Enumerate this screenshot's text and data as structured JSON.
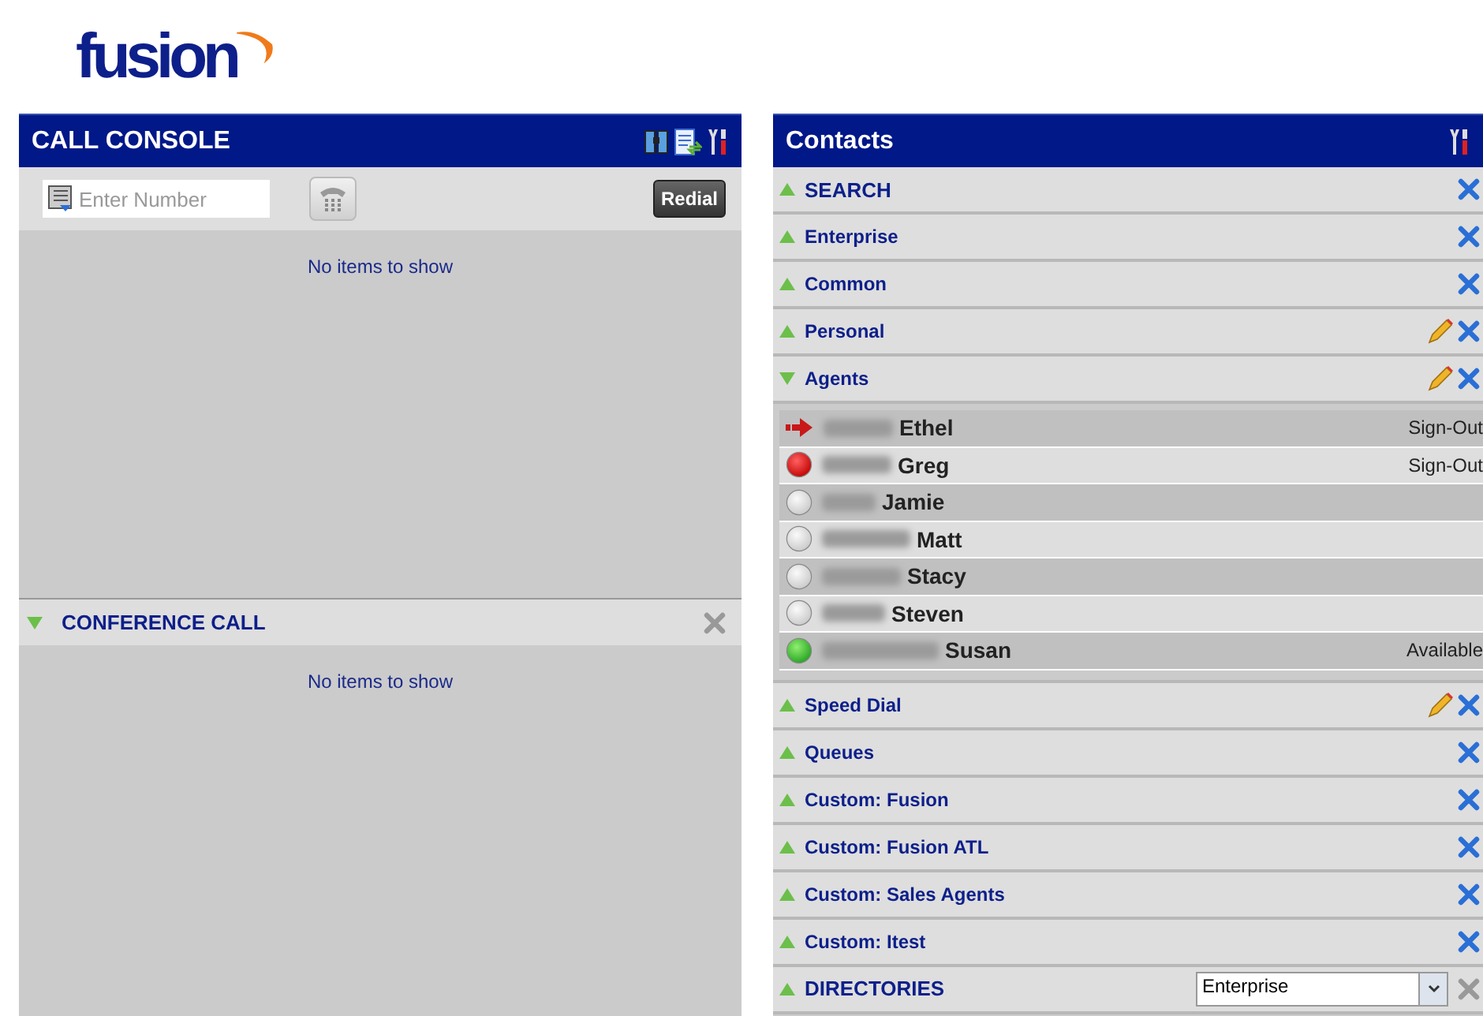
{
  "logo": "fusion",
  "call_console": {
    "title": "CALL CONSOLE",
    "number_placeholder": "Enter Number",
    "redial": "Redial",
    "empty": "No items to show",
    "conference": {
      "title": "CONFERENCE CALL",
      "expanded": true,
      "empty": "No items to show"
    }
  },
  "contacts": {
    "title": "Contacts",
    "sections": [
      {
        "label": "SEARCH",
        "expanded": false,
        "editable": false
      },
      {
        "label": "Enterprise",
        "expanded": false,
        "editable": false
      },
      {
        "label": "Common",
        "expanded": false,
        "editable": false
      },
      {
        "label": "Personal",
        "expanded": false,
        "editable": true
      },
      {
        "label": "Agents",
        "expanded": true,
        "editable": true,
        "agents": [
          {
            "first": "Ethel",
            "kind": "arrow",
            "status": "Sign-Out"
          },
          {
            "first": "Greg",
            "kind": "busy",
            "status": "Sign-Out"
          },
          {
            "first": "Jamie",
            "kind": "offline"
          },
          {
            "first": "Matt",
            "kind": "offline"
          },
          {
            "first": "Stacy",
            "kind": "offline"
          },
          {
            "first": "Steven",
            "kind": "offline"
          },
          {
            "first": "Susan",
            "kind": "available",
            "status": "Available"
          }
        ]
      },
      {
        "label": "Speed Dial",
        "expanded": false,
        "editable": true
      },
      {
        "label": "Queues",
        "expanded": false,
        "editable": false
      },
      {
        "label": "Custom: Fusion",
        "expanded": false,
        "editable": false
      },
      {
        "label": "Custom: Fusion ATL",
        "expanded": false,
        "editable": false
      },
      {
        "label": "Custom: Sales Agents",
        "expanded": false,
        "editable": false
      },
      {
        "label": "Custom: Itest",
        "expanded": false,
        "editable": false
      },
      {
        "label": "DIRECTORIES",
        "expanded": false,
        "editable": false,
        "directory": "Enterprise"
      }
    ]
  }
}
